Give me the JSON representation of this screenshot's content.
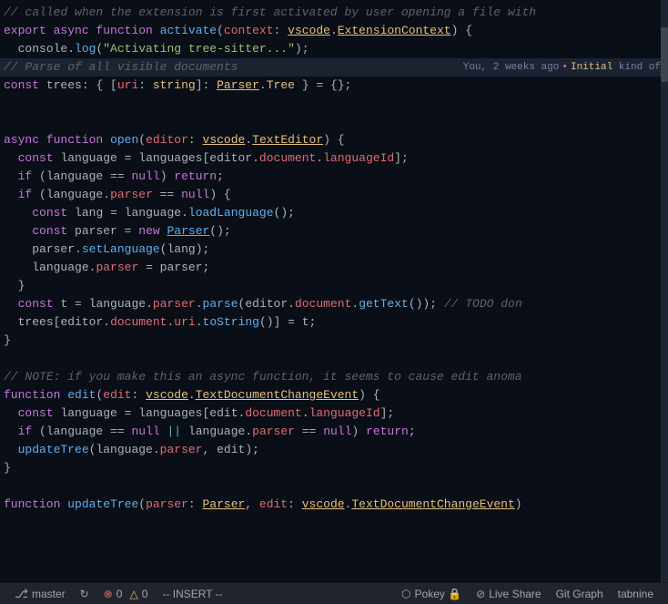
{
  "editor": {
    "background": "#0a0e16",
    "lines": [
      {
        "id": 1,
        "content": "// called when the extension is first activated by user opening a file with",
        "type": "comment",
        "highlight": false
      },
      {
        "id": 2,
        "content": "export async function activate(context: vscode.ExtensionContext) {",
        "highlight": false
      },
      {
        "id": 3,
        "content": "  console.log(\"Activating tree-sitter...\");",
        "highlight": false
      },
      {
        "id": 4,
        "content": "// Parse of all visible documents",
        "annotation": "You, 2 weeks ago • Initial kind of",
        "highlight": true
      },
      {
        "id": 5,
        "content": "const trees: { [uri: string]: Parser.Tree } = {};",
        "highlight": false
      },
      {
        "id": 6,
        "content": "",
        "highlight": false
      },
      {
        "id": 7,
        "content": "",
        "highlight": false
      },
      {
        "id": 8,
        "content": "async function open(editor: vscode.TextEditor) {",
        "highlight": false
      },
      {
        "id": 9,
        "content": "  const language = languages[editor.document.languageId];",
        "highlight": false
      },
      {
        "id": 10,
        "content": "  if (language == null) return;",
        "highlight": false
      },
      {
        "id": 11,
        "content": "  if (language.parser == null) {",
        "highlight": false
      },
      {
        "id": 12,
        "content": "    const lang = language.loadLanguage();",
        "highlight": false
      },
      {
        "id": 13,
        "content": "    const parser = new Parser();",
        "highlight": false
      },
      {
        "id": 14,
        "content": "    parser.setLanguage(lang);",
        "highlight": false
      },
      {
        "id": 15,
        "content": "    language.parser = parser;",
        "highlight": false
      },
      {
        "id": 16,
        "content": "  }",
        "highlight": false
      },
      {
        "id": 17,
        "content": "  const t = language.parser.parse(editor.document.getText()); // TODO don",
        "highlight": false
      },
      {
        "id": 18,
        "content": "  trees[editor.document.uri.toString()] = t;",
        "highlight": false
      },
      {
        "id": 19,
        "content": "}",
        "highlight": false
      },
      {
        "id": 20,
        "content": "",
        "highlight": false
      },
      {
        "id": 21,
        "content": "// NOTE: if you make this an async function, it seems to cause edit anoma",
        "type": "comment",
        "highlight": false
      },
      {
        "id": 22,
        "content": "function edit(edit: vscode.TextDocumentChangeEvent) {",
        "highlight": false
      },
      {
        "id": 23,
        "content": "  const language = languages[edit.document.languageId];",
        "highlight": false
      },
      {
        "id": 24,
        "content": "  if (language == null || language.parser == null) return;",
        "highlight": false
      },
      {
        "id": 25,
        "content": "  updateTree(language.parser, edit);",
        "highlight": false
      },
      {
        "id": 26,
        "content": "}",
        "highlight": false
      },
      {
        "id": 27,
        "content": "",
        "highlight": false
      },
      {
        "id": 28,
        "content": "function updateTree(parser: Parser, edit: vscode.TextDocumentChangeEvent)",
        "highlight": false
      }
    ]
  },
  "status_bar": {
    "branch_icon": "⎇",
    "branch": "master",
    "refresh_icon": "↻",
    "errors": "0",
    "warnings": "0",
    "mode": "-- INSERT --",
    "pokey_icon": "⬡",
    "pokey_label": "Pokey 🔒",
    "live_share_icon": "⊘",
    "live_share_label": "Live Share",
    "git_graph_label": "Git Graph",
    "tabnine_label": "tabnine"
  }
}
